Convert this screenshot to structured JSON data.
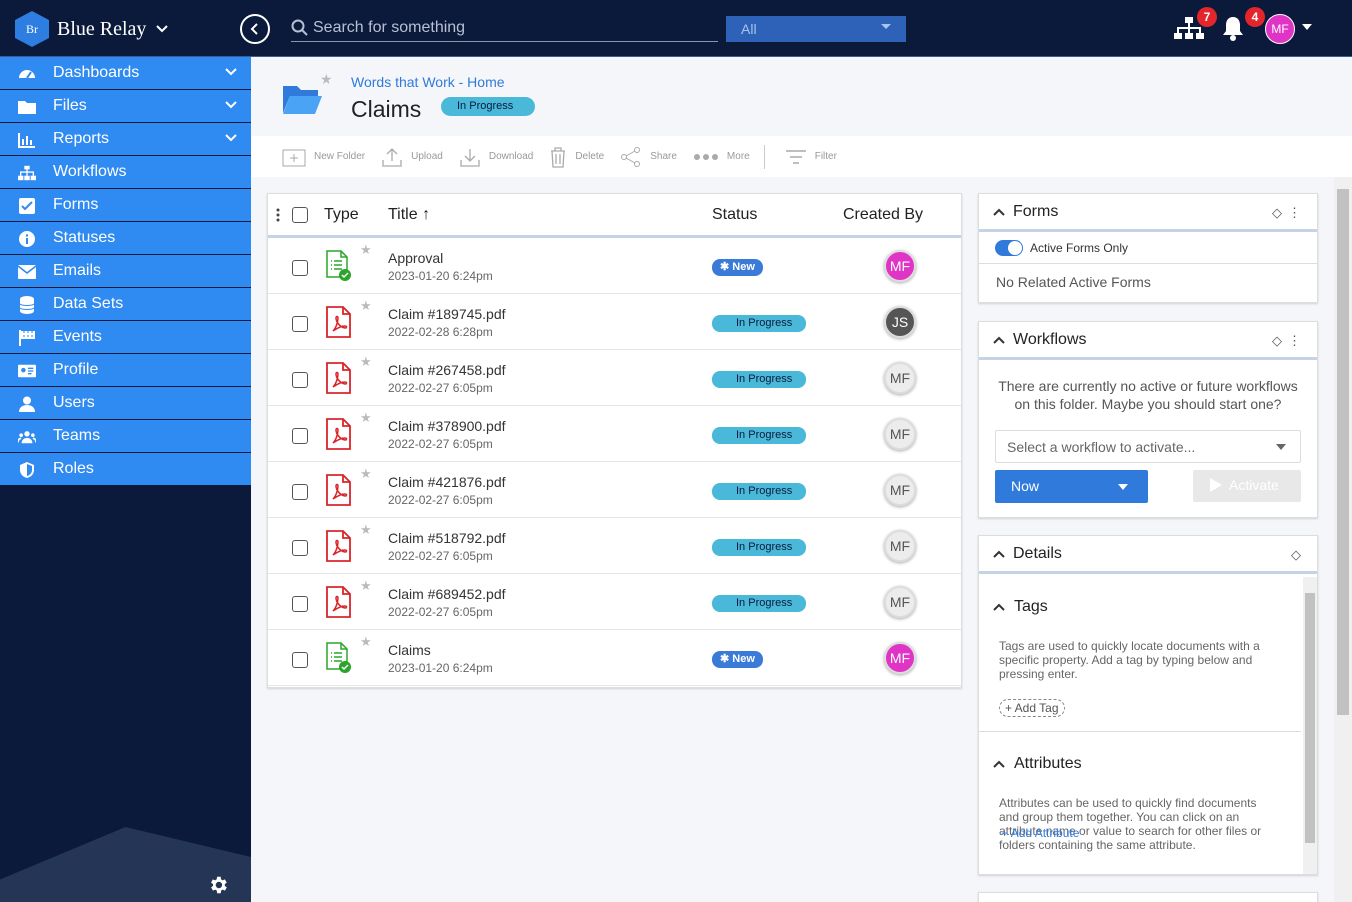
{
  "app": {
    "name": "Blue Relay",
    "logo_text": "Br"
  },
  "topbar": {
    "search_placeholder": "Search for something",
    "scope": "All",
    "workflow_badge": "7",
    "notification_badge": "4",
    "user_initials": "MF"
  },
  "sidebar": {
    "items": [
      {
        "label": "Dashboards",
        "icon": "gauge-icon",
        "expandable": true
      },
      {
        "label": "Files",
        "icon": "folder-icon",
        "expandable": true
      },
      {
        "label": "Reports",
        "icon": "bar-chart-icon",
        "expandable": true
      },
      {
        "label": "Workflows",
        "icon": "sitemap-icon",
        "expandable": false
      },
      {
        "label": "Forms",
        "icon": "checkbox-icon",
        "expandable": false
      },
      {
        "label": "Statuses",
        "icon": "info-icon",
        "expandable": false
      },
      {
        "label": "Emails",
        "icon": "envelope-icon",
        "expandable": false
      },
      {
        "label": "Data Sets",
        "icon": "database-icon",
        "expandable": false
      },
      {
        "label": "Events",
        "icon": "flag-icon",
        "expandable": false
      },
      {
        "label": "Profile",
        "icon": "id-card-icon",
        "expandable": false
      },
      {
        "label": "Users",
        "icon": "user-icon",
        "expandable": false
      },
      {
        "label": "Teams",
        "icon": "users-icon",
        "expandable": false
      },
      {
        "label": "Roles",
        "icon": "shield-icon",
        "expandable": false
      }
    ]
  },
  "header": {
    "breadcrumb": "Words that Work - Home",
    "title": "Claims",
    "status": "In Progress"
  },
  "toolbar": {
    "new_folder": "New Folder",
    "upload": "Upload",
    "download": "Download",
    "delete": "Delete",
    "share": "Share",
    "more": "More",
    "filter": "Filter"
  },
  "table": {
    "columns": {
      "type": "Type",
      "title": "Title",
      "status": "Status",
      "created_by": "Created By"
    },
    "sort_indicator": "↑",
    "rows": [
      {
        "type": "form",
        "title": "Approval",
        "date": "2023-01-20 6:24pm",
        "status": "New",
        "status_kind": "new",
        "initials": "MF",
        "avatar_color": "#e034c6"
      },
      {
        "type": "pdf",
        "title": "Claim #189745.pdf",
        "date": "2022-02-28 6:28pm",
        "status": "In Progress",
        "status_kind": "progress",
        "initials": "JS",
        "avatar_color": "#555555"
      },
      {
        "type": "pdf",
        "title": "Claim #267458.pdf",
        "date": "2022-02-27 6:05pm",
        "status": "In Progress",
        "status_kind": "progress",
        "initials": "MF",
        "avatar_color": "#ececec"
      },
      {
        "type": "pdf",
        "title": "Claim #378900.pdf",
        "date": "2022-02-27 6:05pm",
        "status": "In Progress",
        "status_kind": "progress",
        "initials": "MF",
        "avatar_color": "#ececec"
      },
      {
        "type": "pdf",
        "title": "Claim #421876.pdf",
        "date": "2022-02-27 6:05pm",
        "status": "In Progress",
        "status_kind": "progress",
        "initials": "MF",
        "avatar_color": "#ececec"
      },
      {
        "type": "pdf",
        "title": "Claim #518792.pdf",
        "date": "2022-02-27 6:05pm",
        "status": "In Progress",
        "status_kind": "progress",
        "initials": "MF",
        "avatar_color": "#ececec"
      },
      {
        "type": "pdf",
        "title": "Claim #689452.pdf",
        "date": "2022-02-27 6:05pm",
        "status": "In Progress",
        "status_kind": "progress",
        "initials": "MF",
        "avatar_color": "#ececec"
      },
      {
        "type": "form",
        "title": "Claims",
        "date": "2023-01-20 6:24pm",
        "status": "New",
        "status_kind": "new",
        "initials": "MF",
        "avatar_color": "#e034c6"
      }
    ]
  },
  "forms_panel": {
    "title": "Forms",
    "toggle_label": "Active Forms Only",
    "toggle_on": true,
    "empty_text": "No Related Active Forms"
  },
  "workflows_panel": {
    "title": "Workflows",
    "message": "There are currently no active or future workflows on this folder. Maybe you should start one?",
    "select_placeholder": "Select a workflow to activate...",
    "timing": "Now",
    "activate": "Activate"
  },
  "details_panel": {
    "title": "Details",
    "tags_title": "Tags",
    "tags_text": "Tags are used to quickly locate documents with a specific property. Add a tag by typing below and pressing enter.",
    "add_tag": "+ Add Tag",
    "attributes_title": "Attributes",
    "attributes_text": "Attributes can be used to quickly find documents and group them together. You can click on an attribute name or value to search for other files or folders containing the same attribute.",
    "add_attribute": "Add Attribute"
  },
  "colors": {
    "navy": "#0b1a3b",
    "nav_blue": "#2f8af1",
    "accent": "#2f7adb",
    "status_progress": "#4ab8d9",
    "status_new": "#3b7bd8"
  }
}
